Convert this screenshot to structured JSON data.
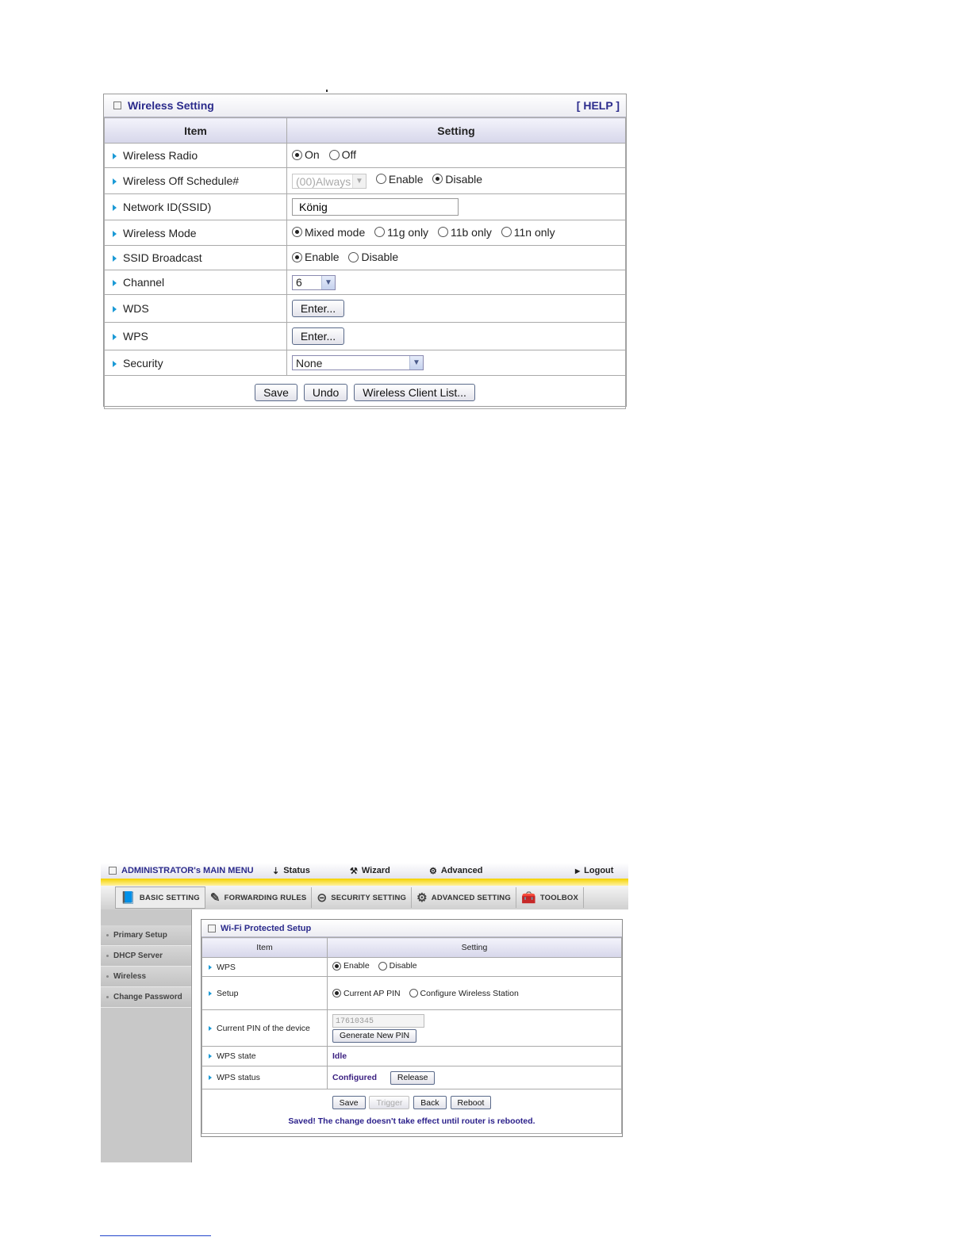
{
  "wireless_setting": {
    "title": "Wireless Setting",
    "help": "[ HELP ]",
    "headers": {
      "item": "Item",
      "setting": "Setting"
    },
    "rows": {
      "radio": {
        "label": "Wireless Radio",
        "opt_on": "On",
        "opt_off": "Off"
      },
      "schedule": {
        "label": "Wireless Off Schedule#",
        "select_value": "(00)Always",
        "opt_enable": "Enable",
        "opt_disable": "Disable"
      },
      "ssid": {
        "label": "Network ID(SSID)",
        "value": "König"
      },
      "mode": {
        "label": "Wireless Mode",
        "opt_mixed": "Mixed mode",
        "opt_11g": "11g only",
        "opt_11b": "11b only",
        "opt_11n": "11n only"
      },
      "broadcast": {
        "label": "SSID Broadcast",
        "opt_enable": "Enable",
        "opt_disable": "Disable"
      },
      "channel": {
        "label": "Channel",
        "value": "6"
      },
      "wds": {
        "label": "WDS",
        "button": "Enter..."
      },
      "wps": {
        "label": "WPS",
        "button": "Enter..."
      },
      "security": {
        "label": "Security",
        "value": "None"
      }
    },
    "buttons": {
      "save": "Save",
      "undo": "Undo",
      "client_list": "Wireless Client List..."
    }
  },
  "admin": {
    "topbar": {
      "main_menu": "ADMINISTRATOR's MAIN MENU",
      "status": "Status",
      "wizard": "Wizard",
      "advanced": "Advanced",
      "logout": "Logout"
    },
    "tabs": {
      "basic": "BASIC SETTING",
      "forwarding": "FORWARDING RULES",
      "security": "SECURITY SETTING",
      "advanced": "ADVANCED SETTING",
      "toolbox": "TOOLBOX"
    },
    "sidebar": [
      "Primary Setup",
      "DHCP Server",
      "Wireless",
      "Change Password"
    ],
    "wps_panel": {
      "title": "Wi-Fi Protected Setup",
      "headers": {
        "item": "Item",
        "setting": "Setting"
      },
      "wps": {
        "label": "WPS",
        "opt_enable": "Enable",
        "opt_disable": "Disable"
      },
      "setup": {
        "label": "Setup",
        "opt_current": "Current AP PIN",
        "opt_configure": "Configure Wireless Station"
      },
      "pin": {
        "label": "Current PIN of the device",
        "value": "17610345",
        "button": "Generate New PIN"
      },
      "state": {
        "label": "WPS state",
        "value": "Idle"
      },
      "status": {
        "label": "WPS status",
        "value": "Configured",
        "button": "Release"
      },
      "buttons": {
        "save": "Save",
        "trigger": "Trigger",
        "back": "Back",
        "reboot": "Reboot"
      },
      "message": "Saved! The change doesn't take effect until router is rebooted."
    }
  }
}
